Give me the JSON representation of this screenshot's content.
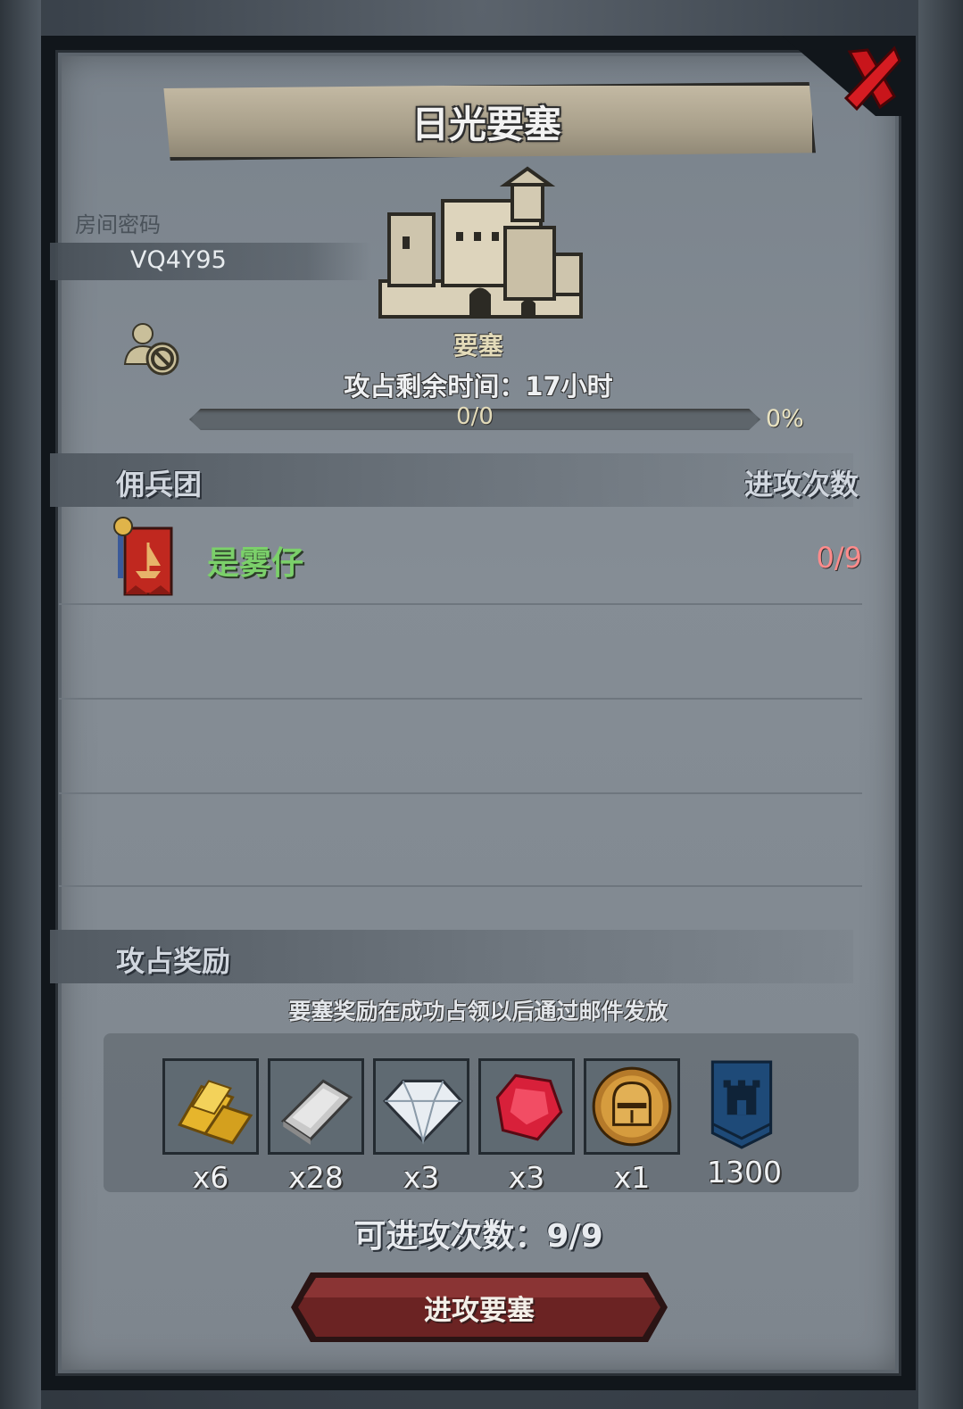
{
  "title": "日光要塞",
  "room": {
    "label": "房间密码",
    "code": "VQ4Y95"
  },
  "fortress": {
    "name": "要塞",
    "remaining_text": "攻占剩余时间：17小时",
    "progress_text": "0/0",
    "progress_percent": "0%",
    "progress_fraction": 0
  },
  "mercenary": {
    "header_left": "佣兵团",
    "header_right": "进攻次数",
    "rows": [
      {
        "name": "是雾仔",
        "count": "0/9",
        "flag_icon": "guild-banner-icon"
      }
    ]
  },
  "rewards": {
    "title": "攻占奖励",
    "note": "要塞奖励在成功占领以后通过邮件发放",
    "items": [
      {
        "icon": "gold-bar-icon",
        "qty": "x6"
      },
      {
        "icon": "silver-bar-icon",
        "qty": "x28"
      },
      {
        "icon": "diamond-icon",
        "qty": "x3"
      },
      {
        "icon": "ruby-icon",
        "qty": "x3"
      },
      {
        "icon": "knight-helmet-coin-icon",
        "qty": "x1"
      },
      {
        "icon": "castle-banner-icon",
        "qty": "1300"
      }
    ]
  },
  "attempts_text": "可进攻次数：9/9",
  "attack_button": "进攻要塞",
  "colors": {
    "merc_name": "#7bd06a",
    "merc_count": "#ff8b8b",
    "close_x": "#c8151b",
    "button": "#6b2323"
  }
}
